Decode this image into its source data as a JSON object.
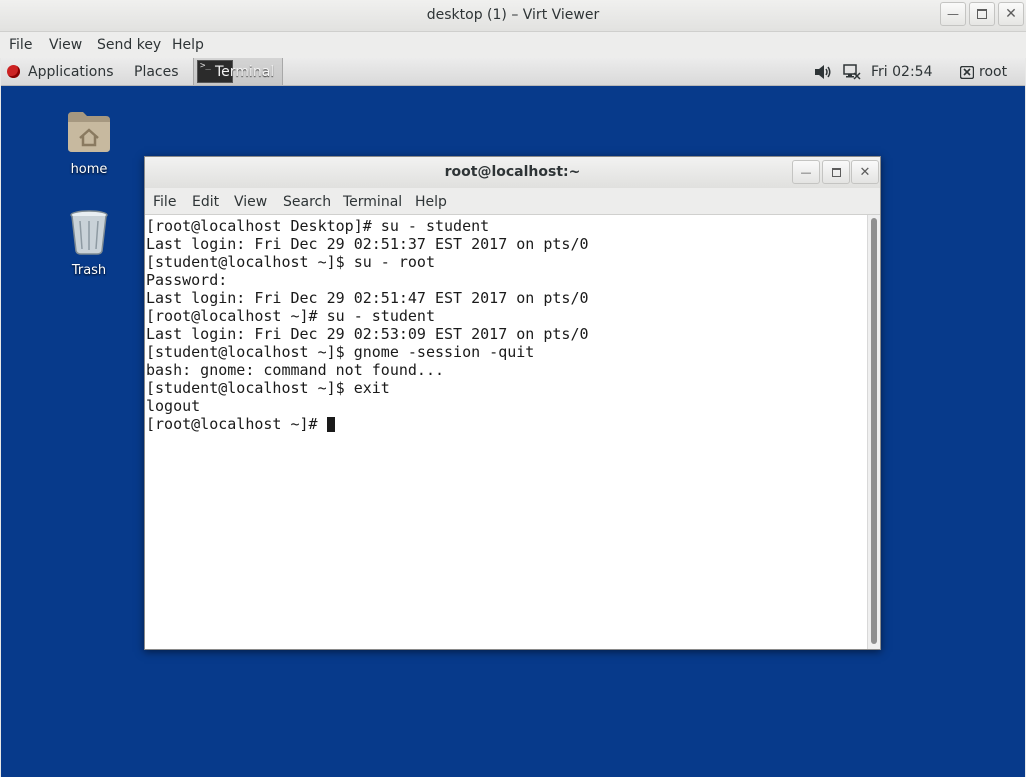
{
  "viewer": {
    "title": "desktop (1) – Virt Viewer",
    "menu": [
      "File",
      "View",
      "Send key",
      "Help"
    ]
  },
  "panel": {
    "applications": "Applications",
    "places": "Places",
    "task_label": "Terminal",
    "clock": "Fri 02:54",
    "user": "root"
  },
  "desktop": {
    "icons": [
      {
        "label": "home",
        "icon": "home-folder-icon"
      },
      {
        "label": "Trash",
        "icon": "trash-icon"
      }
    ]
  },
  "terminal": {
    "title": "root@localhost:~",
    "menu": [
      "File",
      "Edit",
      "View",
      "Search",
      "Terminal",
      "Help"
    ],
    "lines": [
      "[root@localhost Desktop]# su - student",
      "Last login: Fri Dec 29 02:51:37 EST 2017 on pts/0",
      "[student@localhost ~]$ su - root",
      "Password:",
      "Last login: Fri Dec 29 02:51:47 EST 2017 on pts/0",
      "[root@localhost ~]# su - student",
      "Last login: Fri Dec 29 02:53:09 EST 2017 on pts/0",
      "[student@localhost ~]$ gnome -session -quit",
      "bash: gnome: command not found...",
      "[student@localhost ~]$ exit",
      "logout"
    ],
    "prompt": "[root@localhost ~]# "
  },
  "colors": {
    "desktop_background": "#073a8b",
    "terminal_background": "#ffffff",
    "terminal_text": "#1a1a1a"
  }
}
